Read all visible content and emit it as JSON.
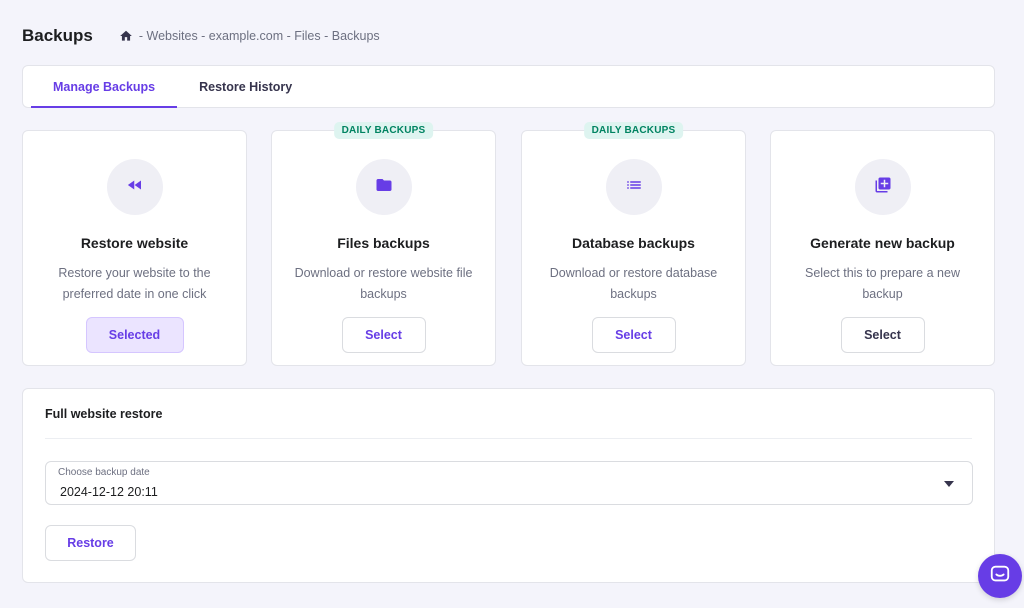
{
  "header": {
    "title": "Backups",
    "breadcrumb": "- Websites - example.com - Files - Backups"
  },
  "tabs": [
    {
      "label": "Manage Backups",
      "active": true
    },
    {
      "label": "Restore History",
      "active": false
    }
  ],
  "cards": [
    {
      "title": "Restore website",
      "description": "Restore your website to the preferred date in one click",
      "button": "Selected",
      "badge": "",
      "icon": "rewind-icon"
    },
    {
      "title": "Files backups",
      "description": "Download or restore website file backups",
      "button": "Select",
      "badge": "DAILY BACKUPS",
      "icon": "folder-icon"
    },
    {
      "title": "Database backups",
      "description": "Download or restore database backups",
      "button": "Select",
      "badge": "DAILY BACKUPS",
      "icon": "list-icon"
    },
    {
      "title": "Generate new backup",
      "description": "Select this to prepare a new backup",
      "button": "Select",
      "badge": "",
      "icon": "add-copy-icon"
    }
  ],
  "restore": {
    "title": "Full website restore",
    "select_label": "Choose backup date",
    "select_value": "2024-12-12 20:11",
    "button": "Restore"
  },
  "colors": {
    "accent": "#673de6",
    "badge_bg": "#def4f0",
    "badge_text": "#008361",
    "background": "#f4f4fb"
  }
}
